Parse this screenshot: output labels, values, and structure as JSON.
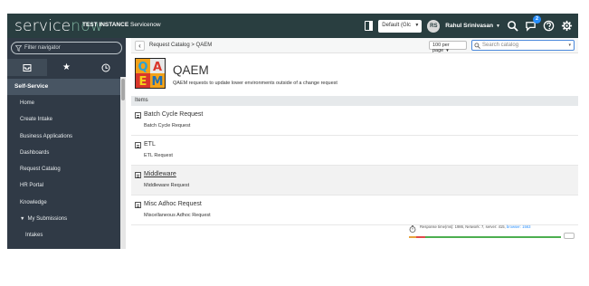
{
  "banner": {
    "logo_part1": "service",
    "logo_part2": "now",
    "instance_label": "TEST INSTANCE",
    "instance_name": "Servicenow",
    "scope": "Default (Glc",
    "user_initials": "RS",
    "user_name": "Rahul Srinivasan",
    "notifications_count": "2",
    "icons": [
      "update-set-icon",
      "search-icon",
      "chat-icon",
      "help-icon",
      "gear-icon"
    ],
    "colors": {
      "background": "#293e40",
      "logo_accent": "#81b5a1",
      "badge": "#278efc"
    }
  },
  "navigator": {
    "filter_placeholder": "Filter navigator",
    "tabs": [
      {
        "name": "all-apps",
        "icon": "inbox-icon",
        "active": true
      },
      {
        "name": "favorites",
        "icon": "star-icon",
        "active": false
      },
      {
        "name": "history",
        "icon": "clock-icon",
        "active": false
      }
    ],
    "application": "Self-Service",
    "items": [
      {
        "label": "Home"
      },
      {
        "label": "Create Intake"
      },
      {
        "label": "Business Applications"
      },
      {
        "label": "Dashboards"
      },
      {
        "label": "Request Catalog"
      },
      {
        "label": "HR Portal"
      },
      {
        "label": "Knowledge"
      },
      {
        "label": "My Submissions",
        "expanded": true
      },
      {
        "label": "Intakes"
      }
    ],
    "colors": {
      "background": "#303a46",
      "section": "#485563"
    }
  },
  "content": {
    "breadcrumb": "Request Catalog > QAEM",
    "per_page": "100 per page",
    "search_placeholder": "Search catalog",
    "category": {
      "title": "QAEM",
      "description": "QAEM requests to update lower environments outside of a change request",
      "logo_letters": [
        "Q",
        "A",
        "E",
        "M"
      ]
    },
    "items_header": "Items",
    "items": [
      {
        "name": "Batch Cycle Request",
        "description": "Batch Cycle Request",
        "highlighted": false
      },
      {
        "name": "ETL",
        "description": "ETL Request",
        "highlighted": false
      },
      {
        "name": "Middleware",
        "description": "Middleware Request",
        "highlighted": true
      },
      {
        "name": "Misc Adhoc Request",
        "description": "Miscellaneous Adhoc Request",
        "highlighted": false
      }
    ],
    "response_time": {
      "prefix": "Response time(ms): 1986, Network: 7, server: 415,",
      "browser": "browser: 1563",
      "segments": [
        {
          "color": "#e8a33d",
          "share": 0.05
        },
        {
          "color": "#e04b4b",
          "share": 0.06
        },
        {
          "color": "#4caf50",
          "share": 0.89
        }
      ]
    }
  }
}
